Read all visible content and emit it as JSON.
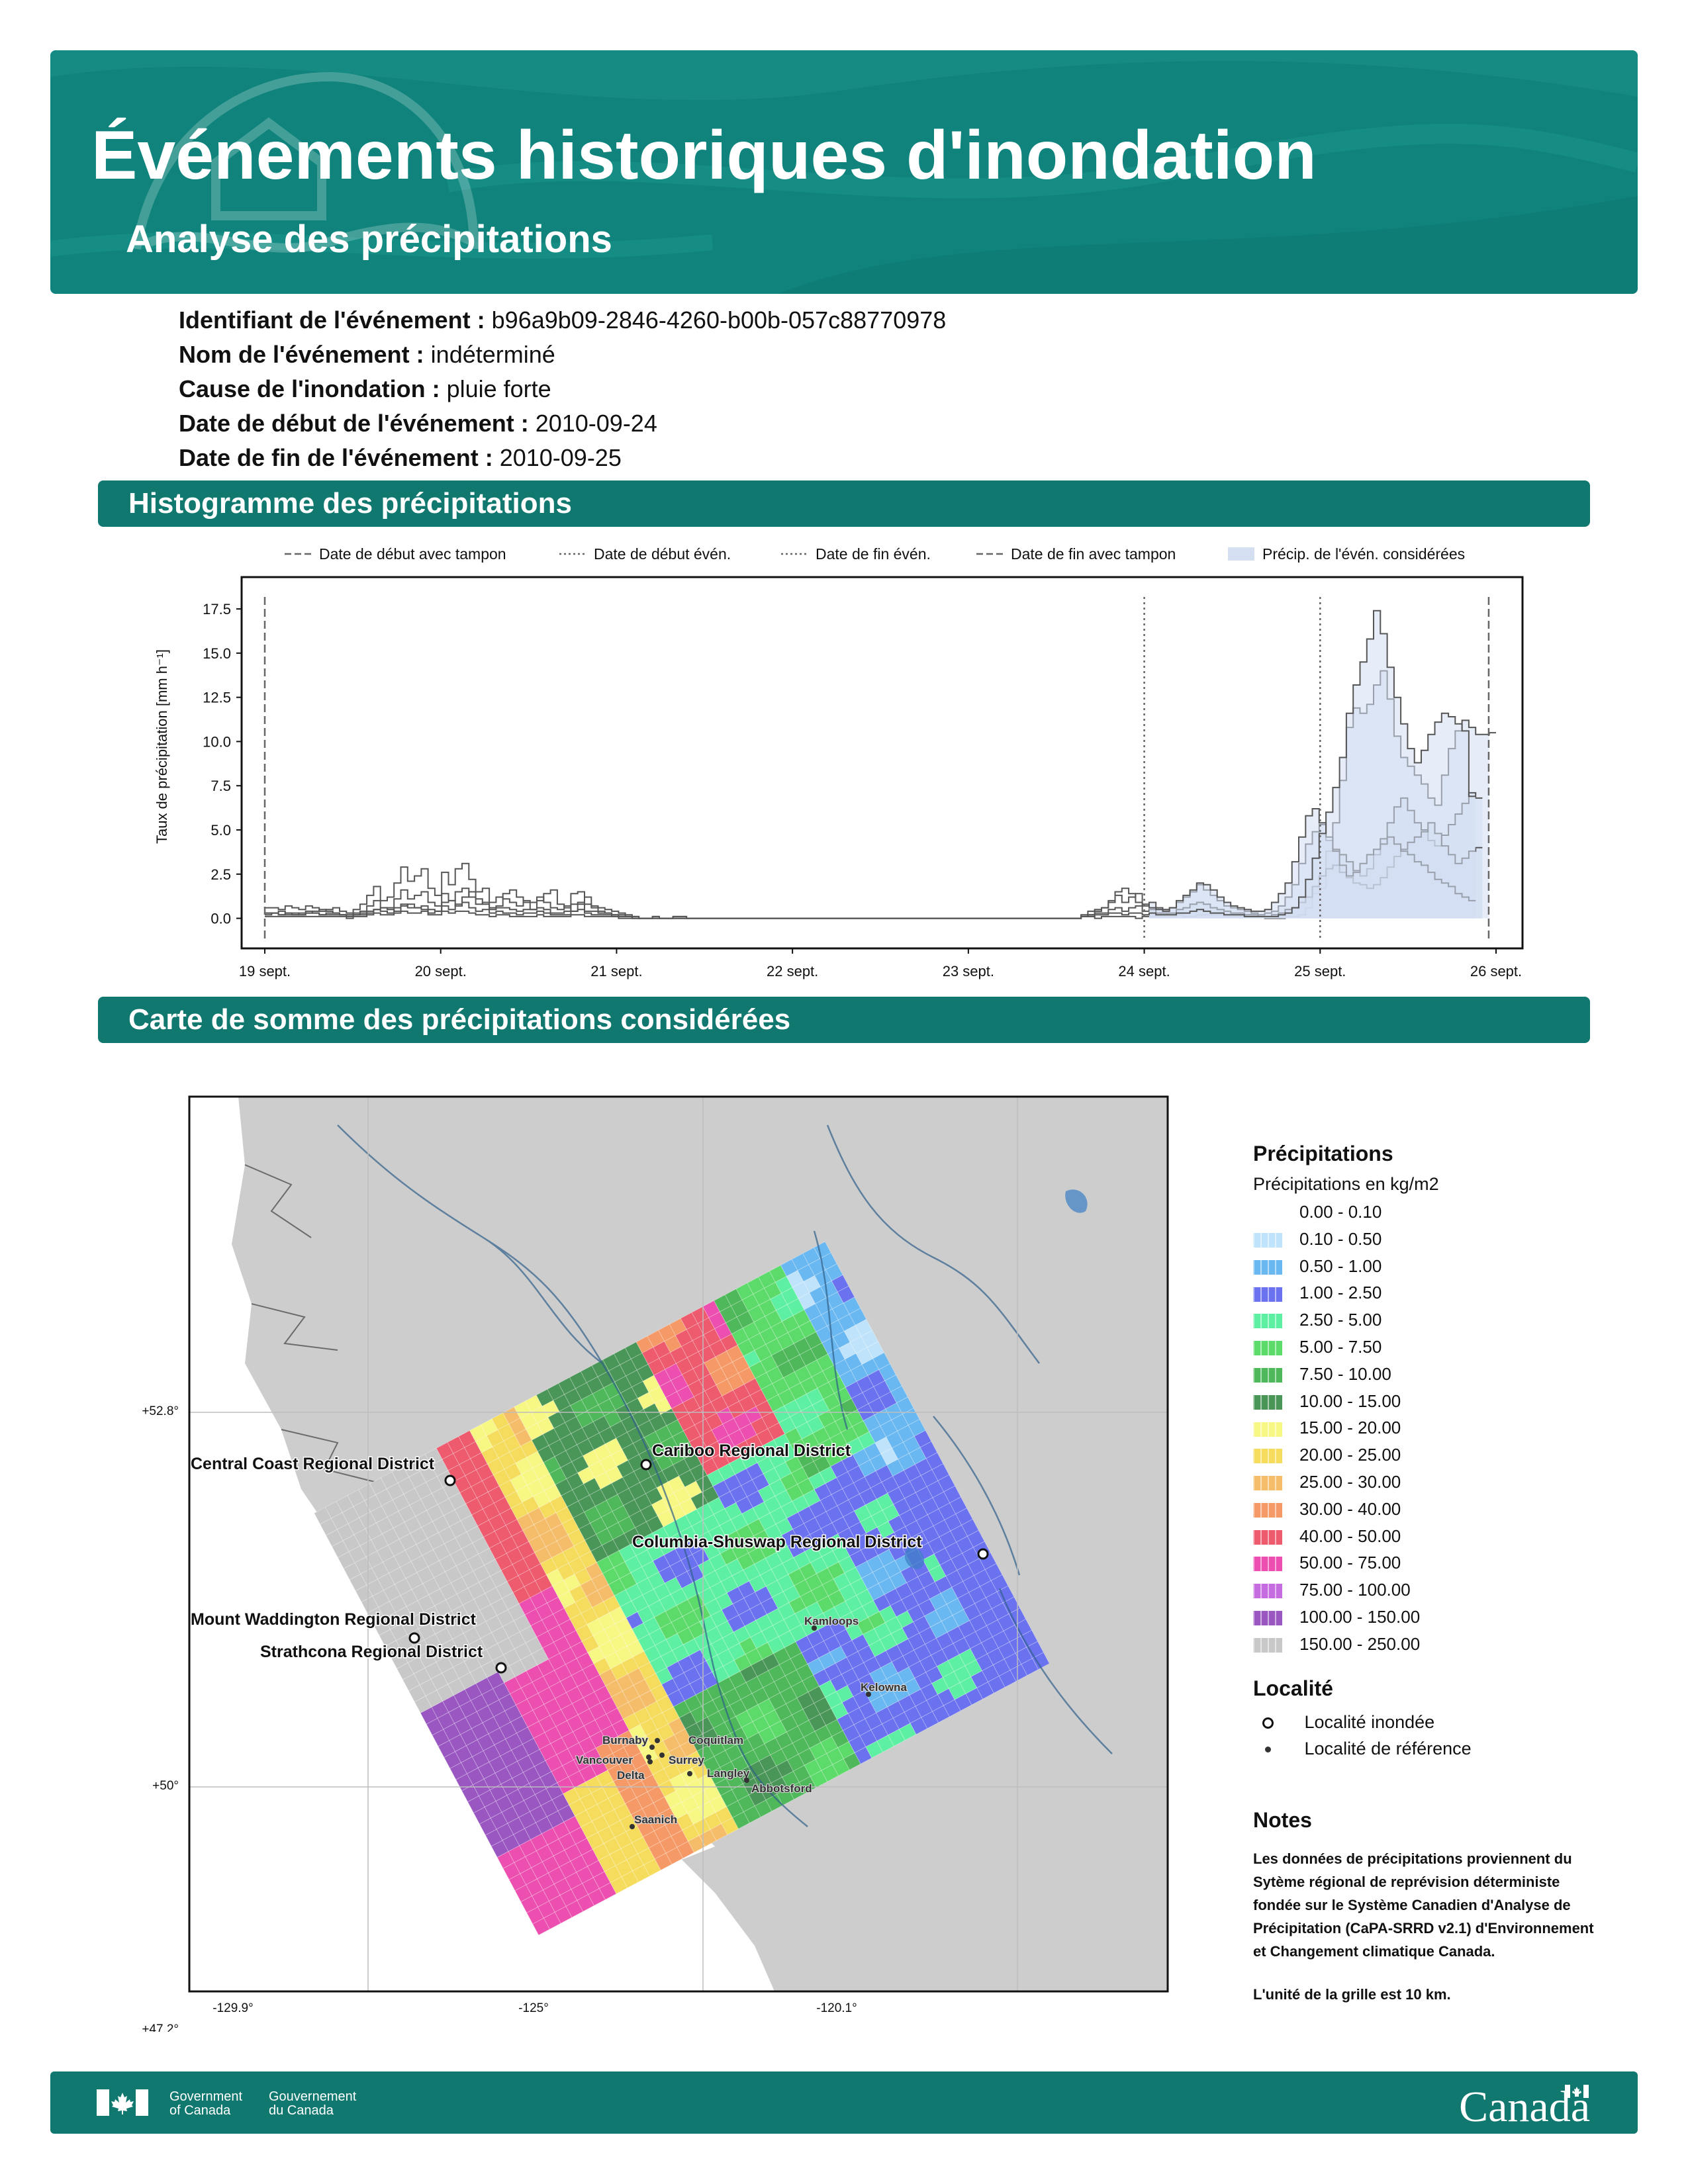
{
  "header": {
    "title": "Événements historiques d'inondation",
    "subtitle": "Analyse des précipitations"
  },
  "event": [
    {
      "label": "Identifiant de l'événement :",
      "value": "b96a9b09-2846-4260-b00b-057c88770978"
    },
    {
      "label": "Nom de l'événement :",
      "value": "indéterminé"
    },
    {
      "label": "Cause de l'inondation :",
      "value": "pluie forte"
    },
    {
      "label": "Date de début de l'événement :",
      "value": "2010-09-24"
    },
    {
      "label": "Date de fin de l'événement :",
      "value": "2010-09-25"
    }
  ],
  "sections": {
    "histogram": "Histogramme des précipitations",
    "map": "Carte de somme des précipitations considérées"
  },
  "chart_data": {
    "type": "line",
    "title": "",
    "xlabel": "",
    "ylabel": "Taux de précipitation [mm h⁻¹]",
    "xlim": [
      "2010-09-19",
      "2010-09-26"
    ],
    "ylim": [
      -1.7,
      19.3
    ],
    "yticks": [
      "0.0",
      "2.5",
      "5.0",
      "7.5",
      "10.0",
      "12.5",
      "15.0",
      "17.5"
    ],
    "xticks": [
      "19 sept.",
      "20 sept.",
      "21 sept.",
      "22 sept.",
      "23 sept.",
      "24 sept.",
      "25 sept.",
      "26 sept."
    ],
    "legend_position": "top",
    "legend": [
      {
        "label": "Date de début avec tampon",
        "style": "dashed"
      },
      {
        "label": "Date de début évén.",
        "style": "dotted"
      },
      {
        "label": "Date de fin évén.",
        "style": "dotted"
      },
      {
        "label": "Date de fin avec tampon",
        "style": "dashed"
      },
      {
        "label": "Précip. de l'évén. considérées",
        "style": "fill"
      }
    ],
    "vlines": [
      {
        "x": "2010-09-19 00:00",
        "style": "dashed"
      },
      {
        "x": "2010-09-24 00:00",
        "style": "dotted"
      },
      {
        "x": "2010-09-25 00:00",
        "style": "dotted"
      },
      {
        "x": "2010-09-25 23:00",
        "style": "dashed"
      }
    ],
    "series": [
      {
        "values": [
          0.6,
          0.6,
          0.5,
          0.7,
          0.6,
          0.5,
          0.7,
          0.6,
          0.4,
          0.5,
          0.6,
          0.4,
          0.3,
          0.5,
          0.8,
          1.3,
          1.8,
          1.0,
          1.2,
          2.0,
          2.9,
          2.1,
          2.4,
          2.8,
          1.7,
          1.3,
          2.6,
          1.9,
          2.8,
          3.1,
          2.2,
          1.5,
          1.7,
          0.9,
          1.2,
          1.1,
          0.9,
          0.7,
          1.0,
          0.9,
          1.2,
          0.9,
          0.6,
          0.5,
          0.7,
          1.4,
          1.5,
          0.8,
          0.7,
          0.6,
          0.5,
          0.4,
          0.3,
          0.2,
          0.1,
          0.0,
          0.0,
          0.1,
          0.0,
          0.0,
          0.1,
          0.1,
          0.0,
          0.0,
          0.0,
          0.0,
          0.0,
          0.0,
          0.0,
          0.0,
          0.0,
          0.0,
          0.0,
          0.0,
          0.0,
          0.0,
          0.0,
          0.0,
          0.0,
          0.0,
          0.0,
          0.0,
          0.0,
          0.0,
          0.0,
          0.0,
          0.0,
          0.0,
          0.0,
          0.0,
          0.0,
          0.0,
          0.0,
          0.0,
          0.0,
          0.0,
          0.0,
          0.0,
          0.0,
          0.0,
          0.0,
          0.0,
          0.0,
          0.0,
          0.0,
          0.0,
          0.0,
          0.0,
          0.0,
          0.0,
          0.0,
          0.0,
          0.0,
          0.0,
          0.0,
          0.0,
          0.0,
          0.0,
          0.0,
          0.0,
          0.1,
          0.1,
          0.0,
          0.1,
          0.1,
          0.1,
          0.1,
          0.1,
          0.0,
          0.1,
          0.1,
          0.1,
          0.1,
          0.1,
          0.2,
          0.1,
          0.1,
          0.2,
          0.2,
          0.2,
          0.2,
          0.1,
          0.1,
          0.1,
          0.1,
          0.1,
          0.1,
          0.0,
          0.0,
          0.0,
          0.1,
          0.1,
          0.2,
          0.6,
          1.4,
          1.7,
          3.8,
          5.4,
          7.8,
          10.8,
          11.9,
          11.6,
          12.1,
          13.2,
          14.0,
          12.4,
          10.3,
          9.1,
          8.6,
          8.1,
          7.6,
          6.8,
          6.4,
          8.1,
          9.6,
          10.6,
          11.2,
          10.8,
          10.4,
          10.4,
          10.5
        ]
      },
      {
        "values": [
          0.3,
          0.3,
          0.2,
          0.3,
          0.3,
          0.2,
          0.4,
          0.3,
          0.2,
          0.3,
          0.3,
          0.2,
          0.1,
          0.2,
          0.4,
          0.7,
          1.0,
          0.6,
          0.6,
          1.1,
          1.6,
          1.1,
          1.3,
          1.5,
          0.9,
          0.7,
          1.4,
          1.0,
          1.5,
          1.7,
          1.2,
          0.8,
          0.9,
          0.5,
          0.6,
          0.6,
          0.5,
          0.4,
          0.5,
          0.5,
          0.6,
          0.5,
          0.3,
          0.3,
          0.4,
          0.8,
          0.8,
          0.4,
          0.4,
          0.3,
          0.3,
          0.2,
          0.2,
          0.1,
          0.1,
          0.0,
          0.0,
          0.1,
          0.0,
          0.0,
          0.1,
          0.1,
          0.0,
          0.0,
          0.0,
          0.0,
          0.0,
          0.0,
          0.0,
          0.0,
          0.0,
          0.0,
          0.0,
          0.0,
          0.0,
          0.0,
          0.0,
          0.0,
          0.0,
          0.0,
          0.0,
          0.0,
          0.0,
          0.0,
          0.0,
          0.0,
          0.0,
          0.0,
          0.0,
          0.0,
          0.0,
          0.0,
          0.0,
          0.0,
          0.0,
          0.0,
          0.0,
          0.0,
          0.0,
          0.0,
          0.0,
          0.0,
          0.0,
          0.0,
          0.0,
          0.0,
          0.0,
          0.0,
          0.0,
          0.0,
          0.0,
          0.0,
          0.0,
          0.0,
          0.0,
          0.0,
          0.0,
          0.0,
          0.0,
          0.0,
          0.2,
          0.4,
          0.5,
          0.6,
          1.0,
          1.3,
          0.9,
          1.2,
          1.4,
          0.7,
          0.9,
          0.6,
          0.5,
          0.6,
          0.9,
          1.2,
          1.5,
          1.9,
          1.6,
          1.3,
          1.0,
          0.7,
          0.6,
          0.5,
          0.4,
          0.3,
          0.2,
          0.3,
          0.4,
          0.7,
          1.2,
          1.9,
          3.1,
          4.2,
          4.9,
          5.3,
          4.4,
          3.9,
          3.6,
          3.2,
          2.7,
          2.4,
          2.8,
          3.6,
          4.5,
          5.4,
          6.3,
          6.8,
          6.1,
          5.4,
          5.0,
          4.4,
          4.1,
          4.7,
          5.3,
          5.9,
          6.5,
          7.1,
          6.8
        ]
      },
      {
        "values": [
          0.1,
          0.1,
          0.1,
          0.1,
          0.1,
          0.1,
          0.1,
          0.1,
          0.1,
          0.1,
          0.1,
          0.1,
          0.0,
          0.1,
          0.1,
          0.2,
          0.3,
          0.2,
          0.2,
          0.3,
          0.4,
          0.3,
          0.3,
          0.4,
          0.2,
          0.2,
          0.4,
          0.3,
          0.4,
          0.4,
          0.3,
          0.2,
          0.2,
          0.1,
          0.2,
          0.2,
          0.1,
          0.1,
          0.1,
          0.1,
          0.2,
          0.1,
          0.1,
          0.1,
          0.1,
          0.2,
          0.2,
          0.1,
          0.1,
          0.1,
          0.1,
          0.1,
          0.0,
          0.0,
          0.0,
          0.0,
          0.0,
          0.0,
          0.0,
          0.0,
          0.0,
          0.0,
          0.0,
          0.0,
          0.0,
          0.0,
          0.0,
          0.0,
          0.0,
          0.0,
          0.0,
          0.0,
          0.0,
          0.0,
          0.0,
          0.0,
          0.0,
          0.0,
          0.0,
          0.0,
          0.0,
          0.0,
          0.0,
          0.0,
          0.0,
          0.0,
          0.0,
          0.0,
          0.0,
          0.0,
          0.0,
          0.0,
          0.0,
          0.0,
          0.0,
          0.0,
          0.0,
          0.0,
          0.0,
          0.0,
          0.0,
          0.0,
          0.0,
          0.0,
          0.0,
          0.0,
          0.0,
          0.0,
          0.0,
          0.0,
          0.0,
          0.0,
          0.0,
          0.0,
          0.0,
          0.0,
          0.0,
          0.0,
          0.0,
          0.0,
          0.1,
          0.2,
          0.3,
          0.3,
          0.5,
          0.6,
          0.4,
          0.6,
          0.7,
          0.4,
          0.5,
          0.3,
          0.3,
          0.3,
          0.5,
          0.6,
          0.8,
          0.9,
          0.8,
          0.6,
          0.5,
          0.4,
          0.3,
          0.3,
          0.2,
          0.2,
          0.1,
          0.1,
          0.2,
          0.3,
          0.5,
          0.6,
          0.9,
          1.2,
          1.8,
          2.4,
          2.8,
          3.0,
          2.6,
          2.3,
          2.0,
          1.9,
          1.7,
          1.9,
          2.3,
          2.9,
          3.5,
          3.9,
          4.3,
          4.6,
          4.9,
          5.4,
          4.8,
          4.1,
          3.6,
          3.1,
          3.4,
          3.8,
          4.0
        ]
      },
      {
        "values": [
          0.2,
          0.3,
          0.4,
          0.3,
          0.2,
          0.3,
          0.3,
          0.4,
          0.5,
          0.4,
          0.3,
          0.2,
          0.2,
          0.3,
          0.3,
          0.4,
          0.5,
          0.6,
          0.5,
          0.4,
          0.7,
          0.8,
          0.6,
          0.5,
          0.3,
          0.4,
          0.9,
          1.0,
          0.7,
          1.2,
          1.5,
          1.1,
          0.8,
          0.6,
          0.7,
          1.4,
          1.6,
          1.2,
          0.9,
          0.5,
          1.0,
          1.4,
          1.6,
          0.8,
          0.6,
          0.4,
          0.9,
          1.2,
          0.6,
          0.4,
          0.3,
          0.2,
          0.1,
          0.1,
          0.0,
          0.0,
          0.0,
          0.0,
          0.0,
          0.0,
          0.0,
          0.0,
          0.0,
          0.0,
          0.0,
          0.0,
          0.0,
          0.0,
          0.0,
          0.0,
          0.0,
          0.0,
          0.0,
          0.0,
          0.0,
          0.0,
          0.0,
          0.0,
          0.0,
          0.0,
          0.0,
          0.0,
          0.0,
          0.0,
          0.0,
          0.0,
          0.0,
          0.0,
          0.0,
          0.0,
          0.0,
          0.0,
          0.0,
          0.0,
          0.0,
          0.0,
          0.0,
          0.0,
          0.0,
          0.0,
          0.0,
          0.0,
          0.0,
          0.0,
          0.0,
          0.0,
          0.0,
          0.0,
          0.0,
          0.0,
          0.0,
          0.0,
          0.0,
          0.0,
          0.0,
          0.0,
          0.0,
          0.0,
          0.0,
          0.0,
          0.1,
          0.2,
          0.4,
          0.6,
          0.9,
          1.5,
          1.7,
          1.4,
          0.9,
          0.8,
          0.6,
          0.5,
          0.4,
          0.6,
          1.0,
          1.3,
          1.6,
          2.0,
          1.9,
          1.6,
          1.2,
          0.9,
          0.7,
          0.6,
          0.5,
          0.4,
          0.4,
          0.5,
          0.9,
          1.4,
          2.0,
          3.2,
          4.6,
          5.8,
          6.2,
          5.4,
          4.6,
          3.8,
          3.0,
          2.4,
          2.6,
          3.1,
          3.6,
          3.9,
          4.2,
          4.6,
          4.2,
          3.8,
          3.6,
          3.2,
          3.0,
          2.6,
          2.2,
          2.0,
          1.8,
          1.4,
          1.2,
          1.0
        ]
      },
      {
        "values": [
          0.3,
          0.3,
          0.2,
          0.2,
          0.2,
          0.2,
          0.3,
          0.3,
          0.2,
          0.2,
          0.2,
          0.2,
          0.1,
          0.2,
          0.2,
          0.3,
          0.5,
          0.4,
          0.3,
          0.6,
          0.8,
          0.6,
          0.6,
          0.7,
          0.5,
          0.4,
          0.7,
          0.5,
          0.8,
          0.9,
          0.6,
          0.4,
          0.5,
          0.3,
          0.4,
          0.3,
          0.3,
          0.2,
          0.3,
          0.3,
          0.4,
          0.3,
          0.2,
          0.2,
          0.2,
          0.4,
          0.5,
          0.3,
          0.2,
          0.2,
          0.2,
          0.1,
          0.1,
          0.1,
          0.0,
          0.0,
          0.0,
          0.0,
          0.0,
          0.0,
          0.0,
          0.0,
          0.0,
          0.0,
          0.0,
          0.0,
          0.0,
          0.0,
          0.0,
          0.0,
          0.0,
          0.0,
          0.0,
          0.0,
          0.0,
          0.0,
          0.0,
          0.0,
          0.0,
          0.0,
          0.0,
          0.0,
          0.0,
          0.0,
          0.0,
          0.0,
          0.0,
          0.0,
          0.0,
          0.0,
          0.0,
          0.0,
          0.0,
          0.0,
          0.0,
          0.0,
          0.0,
          0.0,
          0.0,
          0.0,
          0.0,
          0.0,
          0.0,
          0.0,
          0.0,
          0.0,
          0.0,
          0.0,
          0.0,
          0.0,
          0.0,
          0.0,
          0.0,
          0.0,
          0.0,
          0.0,
          0.0,
          0.0,
          0.0,
          0.0,
          0.1,
          0.1,
          0.2,
          0.2,
          0.3,
          0.3,
          0.2,
          0.3,
          0.3,
          0.2,
          0.3,
          0.2,
          0.2,
          0.2,
          0.3,
          0.3,
          0.4,
          0.5,
          0.4,
          0.3,
          0.3,
          0.2,
          0.2,
          0.2,
          0.1,
          0.1,
          0.1,
          0.1,
          0.1,
          0.2,
          0.3,
          0.6,
          1.2,
          2.2,
          3.4,
          4.8,
          6.0,
          7.4,
          9.1,
          11.6,
          13.2,
          14.5,
          15.8,
          17.4,
          16.1,
          14.2,
          12.5,
          11.0,
          9.6,
          8.8,
          9.5,
          10.4,
          11.1,
          11.6,
          11.4,
          11.0,
          10.6,
          6.9
        ]
      }
    ]
  },
  "map": {
    "lat_labels": [
      "+52.8°",
      "+50°",
      "+47.2°"
    ],
    "lon_labels": [
      "-129.9°",
      "-125°",
      "-120.1°"
    ],
    "flooded_localities": [
      "Central Coast Regional District",
      "Cariboo Regional District",
      "Columbia-Shuswap Regional District",
      "Mount Waddington Regional District",
      "Strathcona Regional District"
    ],
    "reference_localities": [
      "Kamloops",
      "Kelowna",
      "Burnaby",
      "Coquitlam",
      "Vancouver",
      "Surrey",
      "Delta",
      "Langley",
      "Abbotsford",
      "Saanich"
    ]
  },
  "legend": {
    "title": "Précipitations",
    "units": "Précipitations en kg/m2",
    "classes": [
      {
        "label": "0.00 - 0.10",
        "color": "#ffffff"
      },
      {
        "label": "0.10 - 0.50",
        "color": "#bfe3fb"
      },
      {
        "label": "0.50 - 1.00",
        "color": "#6ab8f2"
      },
      {
        "label": "1.00 - 2.50",
        "color": "#6b72f0"
      },
      {
        "label": "2.50 - 5.00",
        "color": "#5ef0a2"
      },
      {
        "label": "5.00 - 7.50",
        "color": "#5cdb6a"
      },
      {
        "label": "7.50 - 10.00",
        "color": "#4eb85a"
      },
      {
        "label": "10.00 - 15.00",
        "color": "#4a9658"
      },
      {
        "label": "15.00 - 20.00",
        "color": "#f7f783"
      },
      {
        "label": "20.00 - 25.00",
        "color": "#f5dc5c"
      },
      {
        "label": "25.00 - 30.00",
        "color": "#f5bd69"
      },
      {
        "label": "30.00 - 40.00",
        "color": "#f59a66"
      },
      {
        "label": "40.00 - 50.00",
        "color": "#ee5a6e"
      },
      {
        "label": "50.00 - 75.00",
        "color": "#ec4fb0"
      },
      {
        "label": "75.00 - 100.00",
        "color": "#c56de0"
      },
      {
        "label": "100.00 - 150.00",
        "color": "#9a57c2"
      },
      {
        "label": "150.00 - 250.00",
        "color": "#c8c8c8"
      }
    ],
    "locality_title": "Localité",
    "flooded_label": "Localité inondée",
    "reference_label": "Localité de référence"
  },
  "notes": {
    "title": "Notes",
    "text": "Les données de précipitations proviennent du Sytème régional de reprévision déterministe fondée sur le Système Canadien d'Analyse de Précipitation (CaPA-SRRD v2.1) d'Environnement et Changement climatique Canada.",
    "grid": "L'unité de la grille est 10 km."
  },
  "footer": {
    "gov_en_1": "Government",
    "gov_en_2": "of Canada",
    "gov_fr_1": "Gouvernement",
    "gov_fr_2": "du Canada",
    "wordmark": "Canada"
  },
  "colors": {
    "header_bg": "#10847c",
    "section_bg": "#10786f",
    "fill_series": "#d4dff2",
    "map_land": "#cdcdcd",
    "map_water": "#ffffff"
  }
}
